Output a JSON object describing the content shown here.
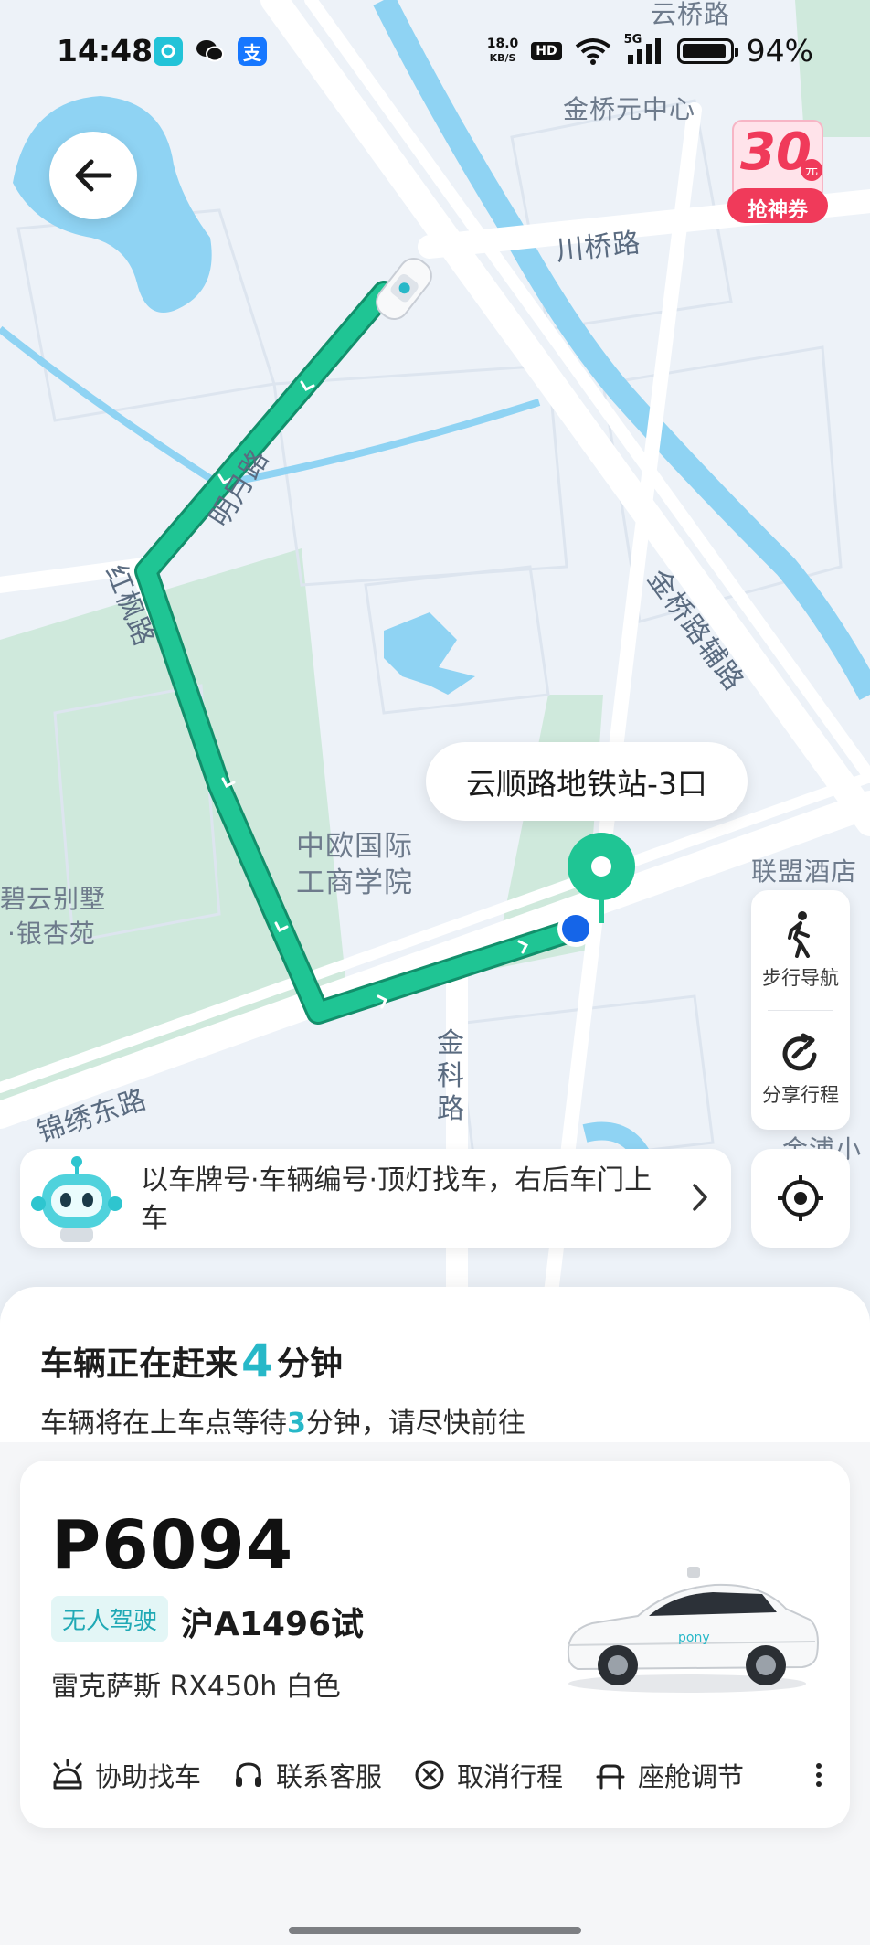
{
  "status_bar": {
    "time": "14:48",
    "app_icons": [
      "app-notification-icon",
      "wechat-icon",
      "alipay-icon"
    ],
    "alipay_glyph": "支",
    "net_speed_value": "18.0",
    "net_speed_unit": "KB/S",
    "hd_badge": "HD",
    "signal_label": "5G",
    "battery_percent": "94%",
    "battery_level": 0.94
  },
  "map": {
    "labels": {
      "yunqiao": "云桥路",
      "jinqiao_center": "金桥元中心",
      "chuanqiao_rd": "川桥路",
      "mingyue_rd": "明月路",
      "hongfeng_rd": "红枫路",
      "jinqiao_aux_rd": "金桥路辅路",
      "ceibs_line1": "中欧国际",
      "ceibs_line2": "工商学院",
      "bivun_line1": "碧云别墅",
      "bivun_line2": "·银杏苑",
      "jinxiu_east_rd": "锦绣东路",
      "jinke_rd": "金科路",
      "lianmeng_hotel": "联盟酒店",
      "jinpu": "金浦小"
    },
    "route_color": "#1fc594",
    "pickup_label": "云顺路地铁站-3口"
  },
  "coupon": {
    "amount": "30",
    "unit": "元",
    "label": "抢神券"
  },
  "side_tools": {
    "walk_nav": "步行导航",
    "share_trip": "分享行程"
  },
  "hint": {
    "text": "以车牌号·车辆编号·顶灯找车，右后车门上车"
  },
  "sheet": {
    "eta_prefix": "车辆正在赶来",
    "eta_minutes": "4",
    "eta_suffix": "分钟",
    "wait_prefix": "车辆将在上车点等待",
    "wait_minutes": "3",
    "wait_suffix": "分钟，请尽快前往"
  },
  "vehicle": {
    "id": "P6094",
    "badge": "无人驾驶",
    "plate": "沪A1496试",
    "model": "雷克萨斯 RX450h 白色",
    "car_logo_text": "pony"
  },
  "actions": [
    {
      "label": "协助找车",
      "icon": "car-horn-icon"
    },
    {
      "label": "联系客服",
      "icon": "headset-icon"
    },
    {
      "label": "取消行程",
      "icon": "cancel-circle-icon"
    },
    {
      "label": "座舱调节",
      "icon": "seat-icon"
    }
  ],
  "colors": {
    "accent": "#27b8c8",
    "route": "#1fc594",
    "user_location": "#1565e8",
    "coupon_red": "#f03a5a"
  }
}
